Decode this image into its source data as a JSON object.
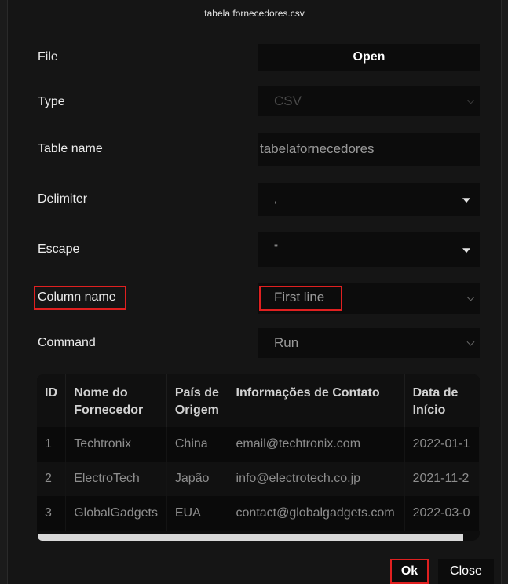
{
  "dialog": {
    "title": "tabela fornecedores.csv"
  },
  "form": {
    "file_label": "File",
    "open_label": "Open",
    "type_label": "Type",
    "type_value": "CSV",
    "table_name_label": "Table name",
    "table_name_value": "tabelafornecedores",
    "delimiter_label": "Delimiter",
    "delimiter_value": ",",
    "escape_label": "Escape",
    "escape_value": "\"",
    "column_name_label": "Column name",
    "column_name_value": "First line",
    "command_label": "Command",
    "command_value": "Run"
  },
  "table": {
    "headers": {
      "id": "ID",
      "nome1": "Nome do",
      "nome2": "Fornecedor",
      "pais1": "País de",
      "pais2": "Origem",
      "info": "Informações de Contato",
      "data1": "Data de",
      "data2": "Início"
    },
    "rows": [
      {
        "id": "1",
        "nome": "Techtronix",
        "pais": "China",
        "info": "email@techtronix.com",
        "data": "2022-01-1"
      },
      {
        "id": "2",
        "nome": "ElectroTech",
        "pais": "Japão",
        "info": "info@electrotech.co.jp",
        "data": "2021-11-2"
      },
      {
        "id": "3",
        "nome": "GlobalGadgets",
        "pais": "EUA",
        "info": "contact@globalgadgets.com",
        "data": "2022-03-0"
      }
    ]
  },
  "footer": {
    "ok_label": "Ok",
    "close_label": "Close"
  },
  "colors": {
    "highlight": "#e02020",
    "background": "#151515",
    "control": "#0c0c0c"
  }
}
